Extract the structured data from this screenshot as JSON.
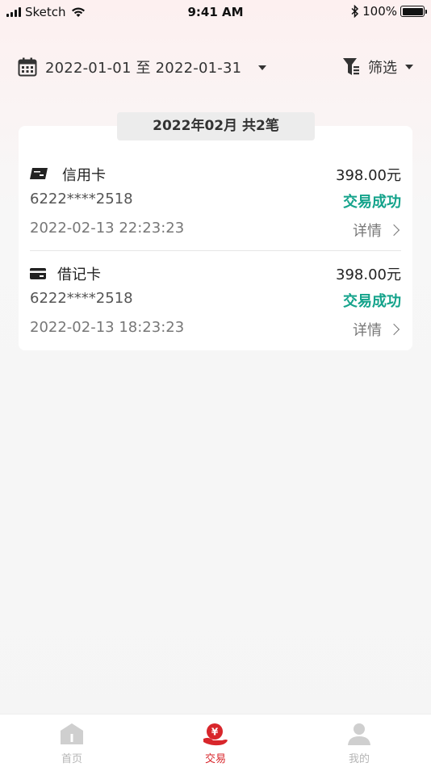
{
  "status_bar": {
    "carrier": "Sketch",
    "time": "9:41 AM",
    "battery": "100%"
  },
  "filter": {
    "date_range": "2022-01-01 至 2022-01-31",
    "filter_label": "筛选"
  },
  "month_summary": "2022年02月  共2笔",
  "transactions": [
    {
      "card_icon": "unionpay-card-icon",
      "card_type": "信用卡",
      "amount": "398.00元",
      "card_no": "6222****2518",
      "status": "交易成功",
      "time": "2022-02-13 22:23:23",
      "detail": "详情"
    },
    {
      "card_icon": "debit-card-icon",
      "card_type": "借记卡",
      "amount": "398.00元",
      "card_no": "6222****2518",
      "status": "交易成功",
      "time": "2022-02-13 18:23:23",
      "detail": "详情"
    }
  ],
  "tabs": [
    {
      "label": "首页",
      "icon": "home-icon",
      "active": false
    },
    {
      "label": "交易",
      "icon": "transaction-icon",
      "active": true
    },
    {
      "label": "我的",
      "icon": "profile-icon",
      "active": false
    }
  ],
  "colors": {
    "accent": "#d8262b",
    "success": "#14a38b"
  }
}
